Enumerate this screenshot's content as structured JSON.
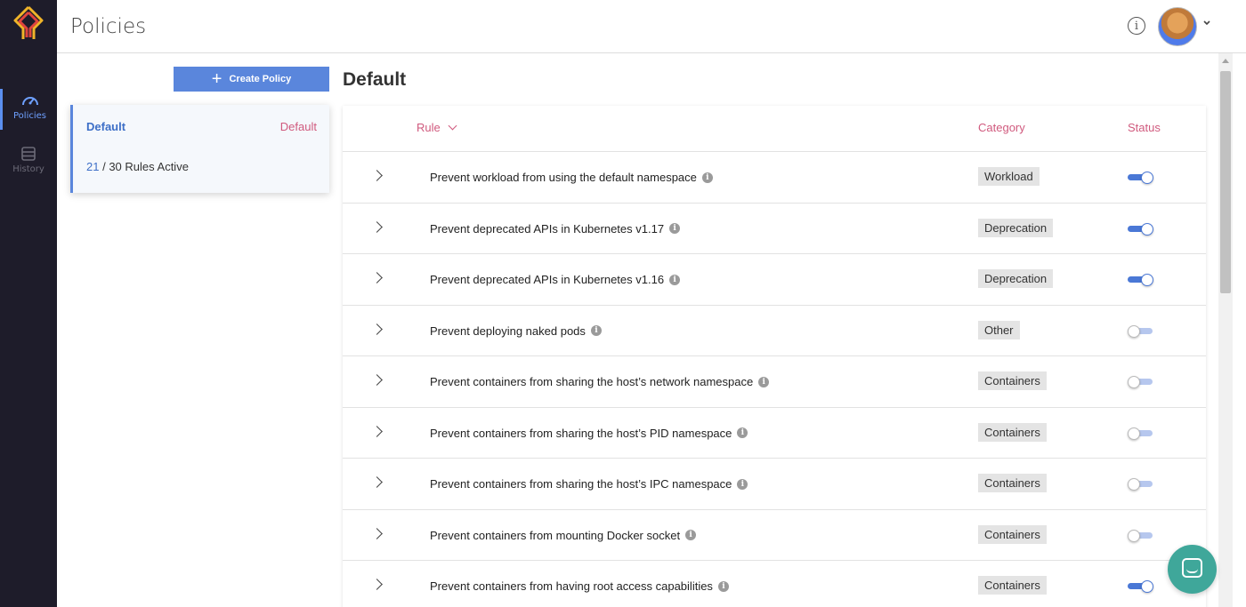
{
  "app": {
    "page_title": "Policies"
  },
  "nav": {
    "items": [
      {
        "label": "Policies",
        "icon": "dashboard-gauge-icon",
        "active": true
      },
      {
        "label": "History",
        "icon": "database-icon",
        "active": false
      }
    ]
  },
  "header": {
    "info_glyph": "i"
  },
  "sidebar": {
    "create_label": "Create Policy",
    "policy": {
      "name": "Default",
      "tag": "Default",
      "active_count": "21",
      "active_suffix": "/ 30 Rules Active"
    }
  },
  "main": {
    "title": "Default",
    "columns": {
      "rule": "Rule",
      "category": "Category",
      "status": "Status"
    },
    "rows": [
      {
        "rule": "Prevent workload from using the default namespace",
        "category": "Workload",
        "enabled": true
      },
      {
        "rule": "Prevent deprecated APIs in Kubernetes v1.17",
        "category": "Deprecation",
        "enabled": true
      },
      {
        "rule": "Prevent deprecated APIs in Kubernetes v1.16",
        "category": "Deprecation",
        "enabled": true
      },
      {
        "rule": "Prevent deploying naked pods",
        "category": "Other",
        "enabled": false
      },
      {
        "rule": "Prevent containers from sharing the host’s network namespace",
        "category": "Containers",
        "enabled": false
      },
      {
        "rule": "Prevent containers from sharing the host’s PID namespace",
        "category": "Containers",
        "enabled": false
      },
      {
        "rule": "Prevent containers from sharing the host’s IPC namespace",
        "category": "Containers",
        "enabled": false
      },
      {
        "rule": "Prevent containers from mounting Docker socket",
        "category": "Containers",
        "enabled": false
      },
      {
        "rule": "Prevent containers from having root access capabilities",
        "category": "Containers",
        "enabled": true
      }
    ]
  },
  "colors": {
    "nav_bg": "#1e1c2a",
    "accent": "#5a86dc",
    "pink": "#d05a7e",
    "chat": "#3fa79a"
  }
}
